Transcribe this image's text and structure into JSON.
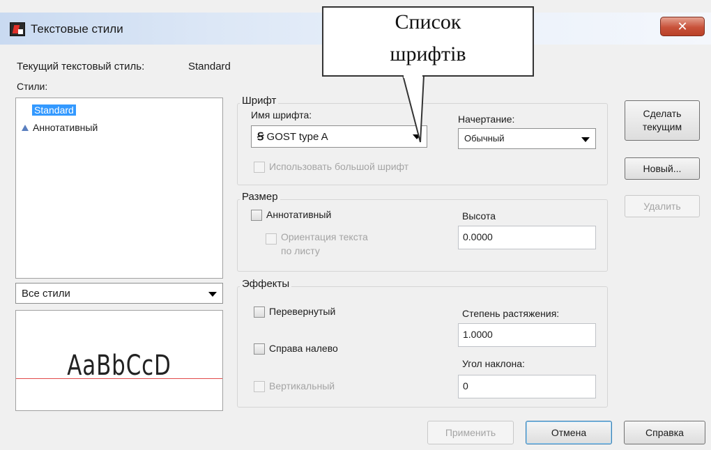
{
  "window": {
    "title": "Текстовые стили",
    "close_glyph": "✕"
  },
  "current_style": {
    "label": "Текущий текстовый стиль:",
    "value": "Standard"
  },
  "styles": {
    "label": "Стили:",
    "items": [
      {
        "label": "Standard",
        "selected": true,
        "icon": ""
      },
      {
        "label": "Аннотативный",
        "selected": false,
        "icon": "annotative-triangle-icon"
      }
    ],
    "filter_value": "Все стили",
    "preview_text": "AaBbCcD"
  },
  "font": {
    "group_label": "Шрифт",
    "name_label": "Имя шрифта:",
    "name_value": "GOST type A",
    "name_icon": "truetype-font-icon",
    "style_label": "Начертание:",
    "style_value": "Обычный",
    "bigfont_label": "Использовать большой шрифт"
  },
  "size": {
    "group_label": "Размер",
    "annotative_label": "Аннотативный",
    "orientation_label_line1": "Ориентация текста",
    "orientation_label_line2": "по листу",
    "height_label": "Высота",
    "height_value": "0.0000"
  },
  "effects": {
    "group_label": "Эффекты",
    "upside_down_label": "Перевернутый",
    "backwards_label": "Справа налево",
    "vertical_label": "Вертикальный",
    "width_label": "Степень растяжения:",
    "width_value": "1.0000",
    "oblique_label": "Угол наклона:",
    "oblique_value": "0"
  },
  "buttons": {
    "set_current_line1": "Сделать",
    "set_current_line2": "текущим",
    "new": "Новый...",
    "delete": "Удалить",
    "apply": "Применить",
    "cancel": "Отмена",
    "help": "Справка"
  },
  "callout": {
    "line1": "Список",
    "line2": "шрифтів"
  },
  "colors": {
    "selection": "#3399ff",
    "close_button": "#c8523a",
    "preview_baseline": "#e24a4a"
  }
}
